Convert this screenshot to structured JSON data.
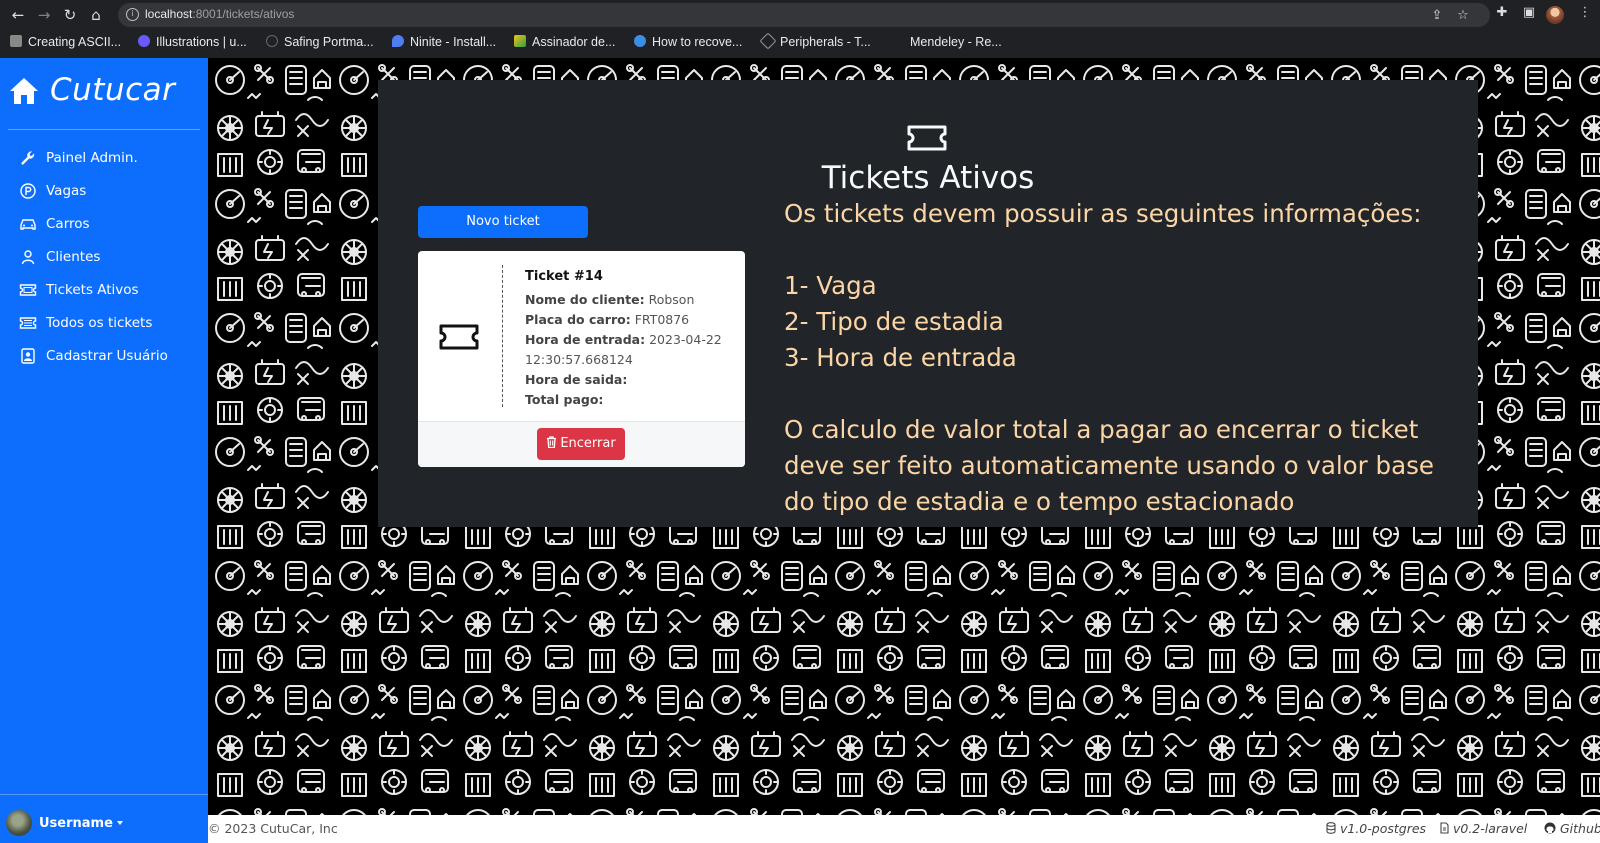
{
  "browser": {
    "url_host": "localhost",
    "url_rest": ":8001/tickets/ativos",
    "bookmarks": [
      {
        "label": "Creating ASCII...",
        "color": "#888"
      },
      {
        "label": "Illustrations | u...",
        "color": "#6a5af9"
      },
      {
        "label": "Safing Portma...",
        "color": "#444"
      },
      {
        "label": "Ninite - Install...",
        "color": "#4f7df3"
      },
      {
        "label": "Assinador de...",
        "color": "#f5c518"
      },
      {
        "label": "How to recove...",
        "color": "#3a8ee6"
      },
      {
        "label": "Peripherals - T...",
        "color": "#777"
      },
      {
        "label": "Mendeley - Re...",
        "color": "#202124"
      }
    ]
  },
  "sidebar": {
    "brand": "Cutucar",
    "items": [
      {
        "label": "Painel Admin.",
        "icon": "wrench-icon"
      },
      {
        "label": "Vagas",
        "icon": "parking-icon"
      },
      {
        "label": "Carros",
        "icon": "car-icon"
      },
      {
        "label": "Clientes",
        "icon": "person-icon"
      },
      {
        "label": "Tickets Ativos",
        "icon": "ticket-icon"
      },
      {
        "label": "Todos os tickets",
        "icon": "ticket-icon"
      },
      {
        "label": "Cadastrar Usuário",
        "icon": "user-badge-icon"
      }
    ],
    "username": "Username"
  },
  "main": {
    "title": "Tickets Ativos",
    "new_ticket_label": "Novo ticket",
    "ticket": {
      "title": "Ticket #14",
      "client_label": "Nome do cliente:",
      "client_value": "Robson",
      "plate_label": "Placa do carro:",
      "plate_value": "FRT0876",
      "entry_label": "Hora de entrada:",
      "entry_value": "2023-04-22 12:30:57.668124",
      "exit_label": "Hora de saida:",
      "paid_label": "Total pago:",
      "end_label": "Encerrar"
    },
    "info": {
      "intro": "Os tickets devem possuir as seguintes informações:",
      "item1": "1- Vaga",
      "item2": "2- Tipo de estadia",
      "item3": "3- Hora de entrada",
      "note": "O calculo de valor total a pagar ao encerrar o ticket deve ser feito automaticamente usando o valor base do tipo de estadia e o tempo estacionado"
    }
  },
  "footer": {
    "copyright": "© 2023 CutuCar, Inc",
    "db_version": "v1.0-postgres",
    "app_version": "v0.2-laravel",
    "github": "Github"
  }
}
